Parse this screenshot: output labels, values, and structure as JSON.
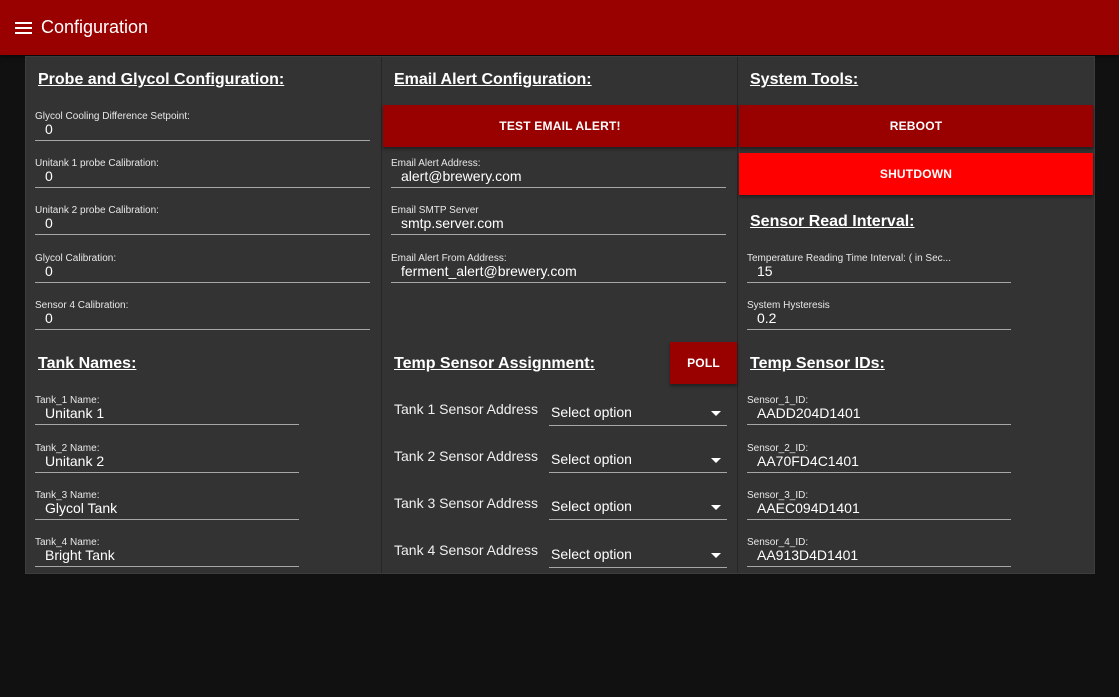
{
  "app": {
    "title": "Configuration"
  },
  "probe": {
    "title": "Probe and Glycol Configuration:",
    "fields": [
      {
        "label": "Glycol Cooling Difference Setpoint:",
        "value": "0"
      },
      {
        "label": "Unitank 1 probe Calibration:",
        "value": "0"
      },
      {
        "label": "Unitank 2 probe Calibration:",
        "value": "0"
      },
      {
        "label": "Glycol Calibration:",
        "value": "0"
      },
      {
        "label": "Sensor 4 Calibration:",
        "value": "0"
      }
    ]
  },
  "tanks": {
    "title": "Tank Names:",
    "fields": [
      {
        "label": "Tank_1 Name:",
        "value": "Unitank 1"
      },
      {
        "label": "Tank_2 Name:",
        "value": "Unitank 2"
      },
      {
        "label": "Tank_3 Name:",
        "value": "Glycol Tank"
      },
      {
        "label": "Tank_4 Name:",
        "value": "Bright Tank"
      }
    ]
  },
  "email": {
    "title": "Email Alert Configuration:",
    "test_button": "TEST EMAIL ALERT!",
    "fields": [
      {
        "label": "Email Alert Address:",
        "value": "alert@brewery.com"
      },
      {
        "label": "Email SMTP Server",
        "value": "smtp.server.com"
      },
      {
        "label": "Email Alert From Address:",
        "value": "ferment_alert@brewery.com"
      }
    ]
  },
  "assignment": {
    "title": "Temp Sensor Assignment:",
    "poll_button": "POLL",
    "rows": [
      {
        "label": "Tank 1 Sensor Address",
        "selected": "Select option"
      },
      {
        "label": "Tank 2 Sensor Address",
        "selected": "Select option"
      },
      {
        "label": "Tank 3 Sensor Address",
        "selected": "Select option"
      },
      {
        "label": "Tank 4 Sensor Address",
        "selected": "Select option"
      }
    ]
  },
  "tools": {
    "title": "System Tools:",
    "reboot_button": "REBOOT",
    "shutdown_button": "SHUTDOWN"
  },
  "interval": {
    "title": "Sensor Read Interval:",
    "fields": [
      {
        "label": "Temperature Reading Time Interval: ( in Sec...",
        "value": "15"
      },
      {
        "label": "System Hysteresis",
        "value": "0.2"
      }
    ]
  },
  "sensor_ids": {
    "title": "Temp Sensor IDs:",
    "fields": [
      {
        "label": "Sensor_1_ID:",
        "value": "AADD204D1401"
      },
      {
        "label": "Sensor_2_ID:",
        "value": "AA70FD4C1401"
      },
      {
        "label": "Sensor_3_ID:",
        "value": "AAEC094D1401"
      },
      {
        "label": "Sensor_4_ID:",
        "value": "AA913D4D1401"
      }
    ]
  },
  "colors": {
    "appbar": "#990000",
    "panel": "#333333",
    "background": "#111111",
    "button_dark": "#990000",
    "button_bright": "#ff0000"
  }
}
